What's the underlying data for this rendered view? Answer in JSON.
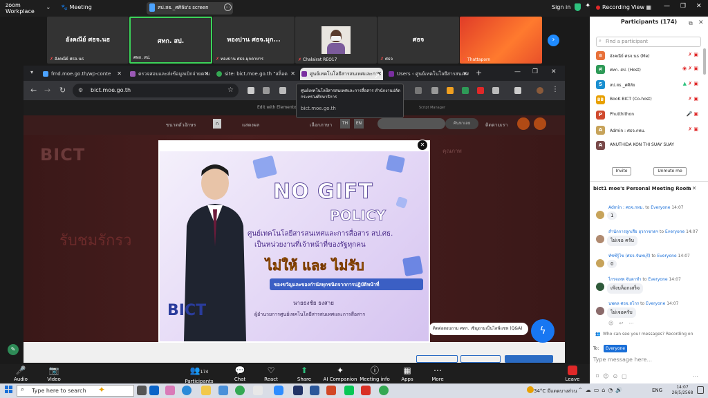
{
  "zoom": {
    "logo_line1": "zoom",
    "logo_line2": "Workplace",
    "meeting_label": "Meeting",
    "share_label": "สป.สธ._ศศิลัย's screen",
    "sign_in": "Sign in",
    "recording": "Recording",
    "view": "View",
    "tiles": [
      {
        "name": "อังคณีย์ ศธจ.นธ",
        "foot": "อังคณีย์ ศธจ.นธ"
      },
      {
        "name": "ศทก. สป.",
        "foot": "ศทก. สป."
      },
      {
        "name": "ทองปาน ศธจ.มุก...",
        "foot": "ทองปาน ศธจ.มุกดาหาร"
      },
      {
        "name": "",
        "foot": "Chalairat REO17"
      },
      {
        "name": "ศธจ",
        "foot": "ศธจ"
      },
      {
        "name": "",
        "foot": "Thattaporn"
      }
    ],
    "bottom": [
      {
        "label": "Audio",
        "icon": "🎤"
      },
      {
        "label": "Video",
        "icon": "📷"
      },
      {
        "label": "Participants",
        "icon": "👥",
        "count": "174"
      },
      {
        "label": "Chat",
        "icon": "💬"
      },
      {
        "label": "React",
        "icon": "♡"
      },
      {
        "label": "Share",
        "icon": "⬆"
      },
      {
        "label": "AI Companion",
        "icon": "✦"
      },
      {
        "label": "Meeting info",
        "icon": "ⓘ"
      },
      {
        "label": "Apps",
        "icon": "▦"
      },
      {
        "label": "More",
        "icon": "⋯"
      }
    ],
    "leave": "Leave"
  },
  "browser": {
    "tabs": [
      {
        "label": "fmd.moe.go.th/wp-conte",
        "color": "#4ca3ff"
      },
      {
        "label": "ตรวจสอบและส่งข้อมูลเบิกจ่ายตามค่าใช้",
        "color": "#9b59b6"
      },
      {
        "label": "site: bict.moe.go.th \"สล็อต",
        "color": "#34a853"
      },
      {
        "label": "ศูนย์เทคโนโลยีสารสนเทศและการ",
        "color": "#7a2ea0"
      },
      {
        "label": "Users ‹ ศูนย์เทคโนโลยีสารสนเทศ",
        "color": "#7a2ea0"
      }
    ],
    "new_tab": "+",
    "url": "bict.moe.go.th",
    "tooltip_title": "ศูนย์เทคโนโลยีสารสนเทศและการสื่อสาร สำนักงานปลัดกระทรวงศึกษาธิการ",
    "tooltip_url": "bict.moe.go.th"
  },
  "website": {
    "edit_elementor": "Edit with Elementor",
    "script_manager": "Script Manager",
    "fontsize_label": "ขนาดตัวอักษร",
    "fontsize_btn": "ก",
    "contrast_label": "แสดงผล",
    "lang_label": "เลือกภาษา",
    "lang_th": "TH",
    "lang_en": "EN",
    "search_btn": "ค้นหาเลย",
    "contact_label": "ติดตามเรา",
    "logo": "BICT",
    "ribbon": "รับชมรักรว",
    "nav": "คุณภาพ",
    "chat_bubble": "ติดต่อสอบถาม ศทก. เชิญถามเป็นไลฟ์แชท (Q&A)"
  },
  "poster": {
    "no_gift": "NO GIFT",
    "policy": "POLICY",
    "org1": "ศูนย์เทคโนโลยีสารสนเทศและการสื่อสาร สป.ศธ.",
    "org2": "เป็นหน่วยงานที่เจ้าหน้าที่ของรัฐทุกคน",
    "main": "ไม่ให้ และ ไม่รับ",
    "band": "ของขวัญและของกำนัลทุกชนิดจากการปฏิบัติหน้าที่",
    "sig1": "นายธงชัย ธงสาย",
    "sig2": "ผู้อำนวยการศูนย์เทคโนโลยีสารสนเทศและการสื่อสาร",
    "bict": "BICT"
  },
  "participants": {
    "title": "Participants (174)",
    "search_placeholder": "Find a participant",
    "list": [
      {
        "name": "อังคณีย์ ศธจ.นธ (Me)",
        "av": "อ",
        "color": "#e8713a"
      },
      {
        "name": "ศทก. สป. (Host)",
        "av": "ศ",
        "color": "#2e9a57"
      },
      {
        "name": "สป.สธ._ศศิลัย",
        "av": "S",
        "color": "#1a8fd0"
      },
      {
        "name": "BooK BICT (Co-host)",
        "av": "BB",
        "color": "#e8a000"
      },
      {
        "name": "Phutthithon",
        "av": "P",
        "color": "#d04a2e"
      },
      {
        "name": "Admin : ศธจ.กทม.",
        "av": "A",
        "color": "#c7a35a"
      },
      {
        "name": "ANUTHIDA KON THI SUAY SUAY",
        "av": "A",
        "color": "#7a4a4a"
      }
    ],
    "invite": "Invite",
    "unmute": "Unmute me"
  },
  "chat": {
    "title": "bict1 moe's Personal Meeting Room",
    "messages": [
      {
        "who": "Admin : ศธจ.กทม.",
        "to": "Everyone",
        "time": "14:07",
        "body": "1"
      },
      {
        "who": "สำนักการลูกเสือ ยุวกาชาดฯ",
        "to": "Everyone",
        "time": "14:07",
        "body": "ไม่เจอ ครับ"
      },
      {
        "who": "ทัชชีรู้ไข (ศธจ.จันทบุรี)",
        "to": "Everyone",
        "time": "14:07",
        "body": "0"
      },
      {
        "who": "ไกรจเทพ จันดาทำ",
        "to": "Everyone",
        "time": "14:07",
        "body": "เพิ่งบล็อกเสร็จ"
      },
      {
        "who": "นพดล ศธจ.สโกร",
        "to": "Everyone",
        "time": "14:07",
        "body": "ไม่เจอครับ"
      }
    ],
    "from_word": "to",
    "who_can_see": "Who can see your messages? Recording on",
    "to_label": "To:",
    "to_value": "Everyone",
    "placeholder": "Type message here..."
  },
  "taskbar": {
    "search": "Type here to search",
    "weather": "34°C  มีแดดบางส่วน",
    "lang": "ENG",
    "time": "14:07",
    "date": "26/5/2568"
  }
}
